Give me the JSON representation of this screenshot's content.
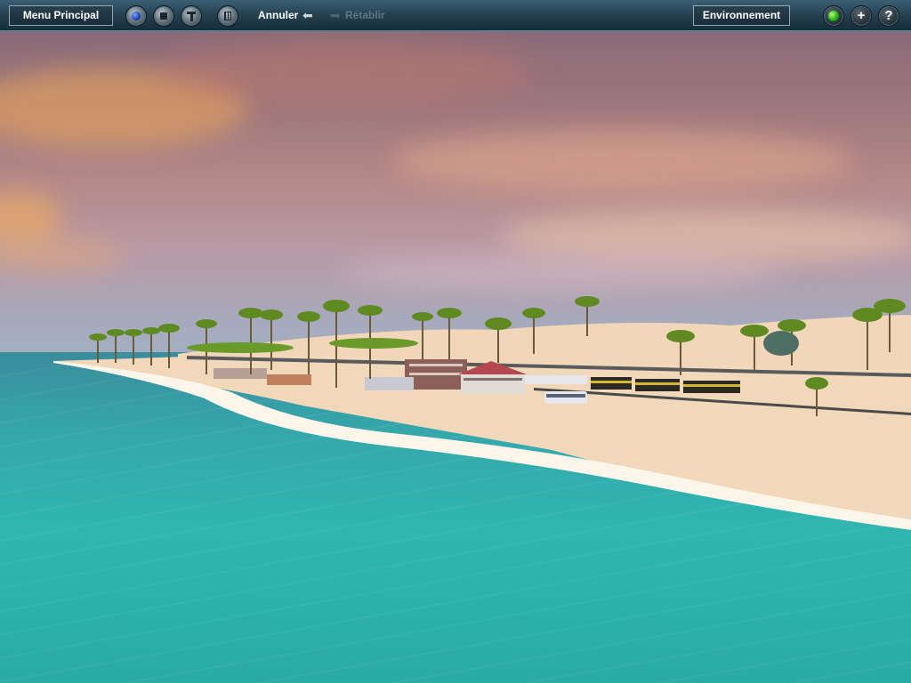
{
  "toolbar": {
    "main_menu_label": "Menu Principal",
    "undo_label": "Annuler",
    "redo_label": "Rétablir",
    "environment_label": "Environnement",
    "tool_icons": [
      "run-sphere-icon",
      "stop-icon",
      "track-tool-icon",
      "delete-icon"
    ],
    "right_icons": [
      "status-light-icon",
      "add-icon",
      "help-icon"
    ],
    "add_glyph": "+",
    "help_glyph": "?",
    "status_color": "#22b414"
  },
  "scene": {
    "description_icons": [
      "palm-tree-icon",
      "train-icon",
      "bus-icon",
      "building-icon"
    ],
    "colors": {
      "sky_top": "#8a6a78",
      "sky_horizon": "#9fb2c4",
      "sea": "#2fb6b0",
      "sand": "#f3dcc0",
      "surf": "#fbf5ea"
    }
  }
}
